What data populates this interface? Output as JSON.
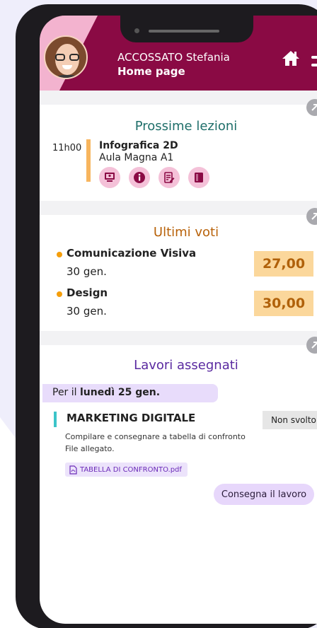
{
  "header": {
    "user_name": "ACCOSSATO Stefania",
    "page_title": "Home page",
    "color": "#8a0a44"
  },
  "lessons": {
    "title": "Prossime lezioni",
    "title_color": "#1f6f6a",
    "items": [
      {
        "time": "11h00",
        "name": "Infografica 2D",
        "room": "Aula Magna A1",
        "icons": [
          "presentation-icon",
          "info-icon",
          "edit-document-icon",
          "book-icon"
        ]
      }
    ]
  },
  "grades": {
    "title": "Ultimi voti",
    "title_color": "#b8620a",
    "items": [
      {
        "subject": "Comunicazione Visiva",
        "date": "30 gen.",
        "grade": "27,00"
      },
      {
        "subject": "Design",
        "date": "30 gen.",
        "grade": "30,00"
      }
    ]
  },
  "assignments": {
    "title": "Lavori assegnati",
    "title_color": "#5a2aa0",
    "due_prefix": "Per il",
    "due_date": "lunedì 25 gen.",
    "item": {
      "title": "MARKETING DIGITALE",
      "status": "Non svolto",
      "description": "Compilare e consegnare a tabella di confronto",
      "file_note": "File allegato.",
      "attachment": "TABELLA DI CONFRONTO.pdf",
      "submit_label": "Consegna il lavoro"
    }
  }
}
